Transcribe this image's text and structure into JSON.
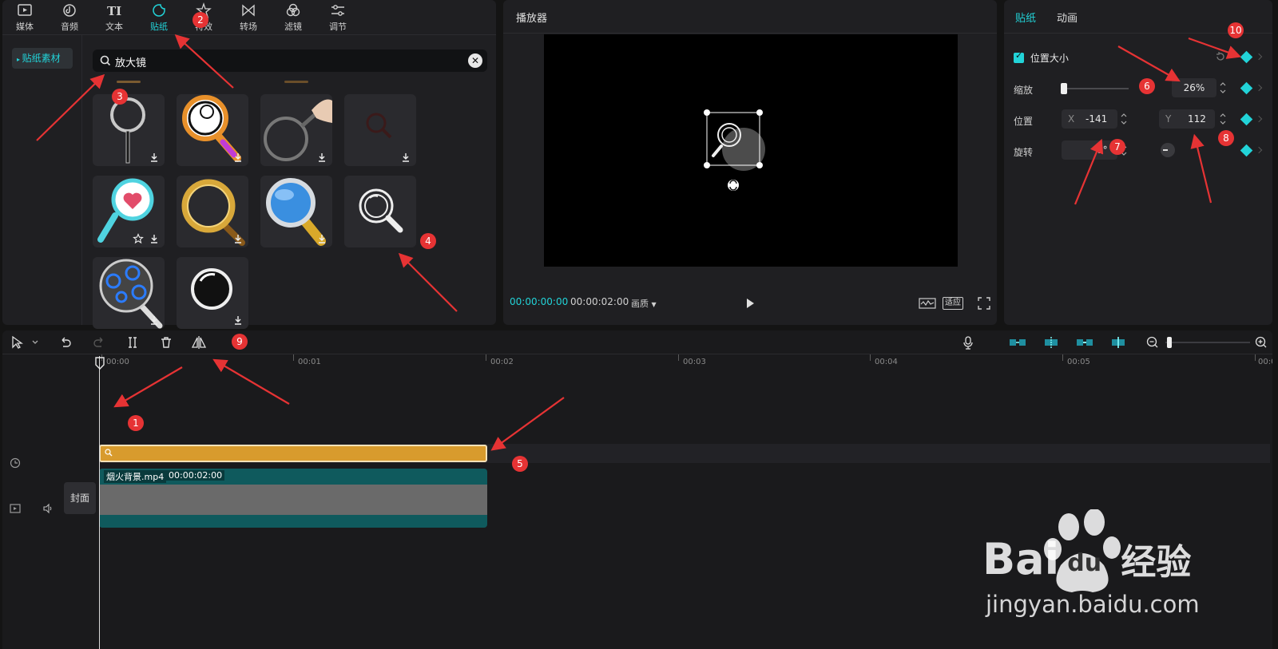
{
  "toolbar": {
    "tabs": [
      {
        "label": "媒体",
        "icon": "media-icon"
      },
      {
        "label": "音频",
        "icon": "audio-icon"
      },
      {
        "label": "文本",
        "icon": "text-icon"
      },
      {
        "label": "贴纸",
        "icon": "sticker-icon",
        "active": true
      },
      {
        "label": "特效",
        "icon": "effects-icon"
      },
      {
        "label": "转场",
        "icon": "transition-icon"
      },
      {
        "label": "滤镜",
        "icon": "filter-icon"
      },
      {
        "label": "调节",
        "icon": "adjust-icon"
      }
    ]
  },
  "library": {
    "side_item": "贴纸素材",
    "search_value": "放大镜"
  },
  "player": {
    "title": "播放器",
    "current_time": "00:00:00:00",
    "total_time": "00:00:02:00",
    "quality_label": "画质",
    "fit_label": "适应"
  },
  "inspector": {
    "tabs": [
      "贴纸",
      "动画"
    ],
    "section_title": "位置大小",
    "scale_label": "缩放",
    "scale_value": "26%",
    "position_label": "位置",
    "x_label": "X",
    "x_value": "-141",
    "y_label": "Y",
    "y_value": "112",
    "rotate_label": "旋转",
    "rotate_value": "0°"
  },
  "timeline": {
    "ticks": [
      "00:00",
      "00:01",
      "00:02",
      "00:03",
      "00:04",
      "00:05",
      "00:0"
    ],
    "video_clip_name": "烟火背景.mp4",
    "video_clip_duration": "00:00:02:00",
    "cover_label": "封面"
  },
  "annotations": [
    "1",
    "2",
    "3",
    "4",
    "5",
    "6",
    "7",
    "8",
    "9",
    "10"
  ],
  "watermark": {
    "url": "jingyan.baidu.com",
    "brand_text": "Bai",
    "brand_du": "du",
    "brand_cn": "经验"
  },
  "colors": {
    "accent": "#22d3d8",
    "annotation": "#e63334",
    "sticker_clip": "#d89b2d",
    "video_clip": "#0f5a5d"
  }
}
